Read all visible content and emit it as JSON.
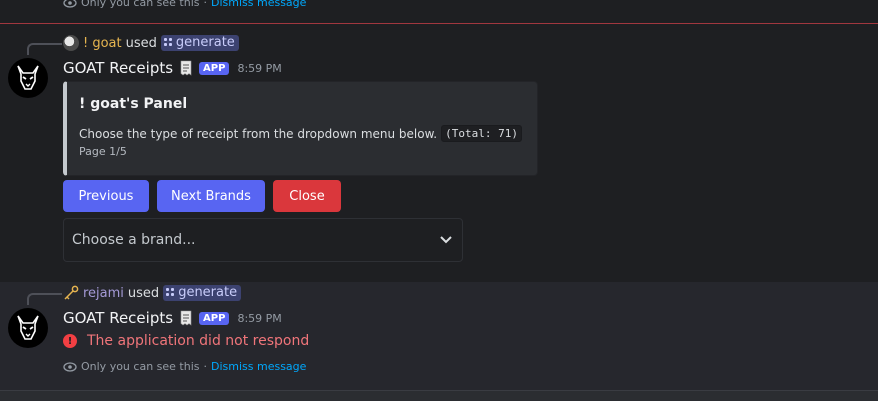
{
  "top_ephemeral": {
    "text": "Only you can see this",
    "separator": "·",
    "dismiss": "Dismiss message"
  },
  "message1": {
    "reply": {
      "user": "! goat",
      "used": "used",
      "command": "generate"
    },
    "bot_name": "GOAT Receipts",
    "badge": "APP",
    "time": "8:59 PM",
    "embed": {
      "title": "! goat's Panel",
      "description": "Choose the type of receipt from the dropdown menu below.",
      "total": "(Total: 71)",
      "footer": "Page 1/5",
      "accent_color": "#c4c9ce"
    },
    "buttons": {
      "previous": "Previous",
      "next": "Next Brands",
      "close": "Close"
    },
    "select": {
      "placeholder": "Choose a brand..."
    }
  },
  "message2": {
    "reply": {
      "user": "rejami",
      "used": "used",
      "command": "generate"
    },
    "bot_name": "GOAT Receipts",
    "badge": "APP",
    "time": "8:59 PM",
    "error": "The application did not respond",
    "ephemeral": {
      "text": "Only you can see this",
      "separator": "·",
      "dismiss": "Dismiss message"
    }
  },
  "colors": {
    "blurple": "#5865f2",
    "danger": "#da373c",
    "error_text": "#f0757a",
    "link": "#00a8fc"
  }
}
